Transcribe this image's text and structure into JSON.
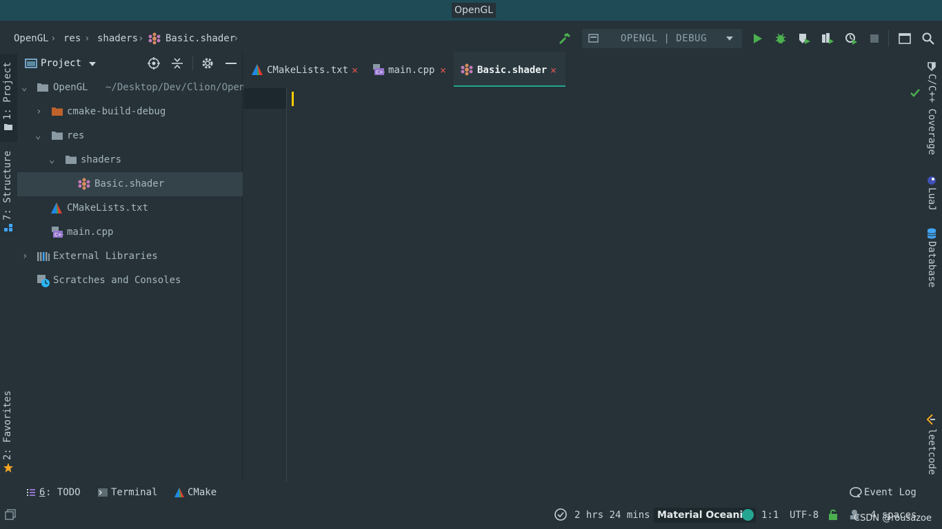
{
  "window": {
    "title": "OpenGL"
  },
  "breadcrumb": [
    "OpenGL",
    "res",
    "shaders",
    "Basic.shader"
  ],
  "toolbar": {
    "run_config": "OPENGL | DEBUG",
    "icons": [
      "hammer-icon",
      "config-icon",
      "chevron-down-icon",
      "run-icon",
      "debug-icon",
      "coverage-icon",
      "profile-icon",
      "attach-icon",
      "stop-icon",
      "terminal-icon",
      "search-icon"
    ]
  },
  "left_tabs": {
    "project": "1: Project",
    "structure": "7: Structure",
    "favorites": "2: Favorites"
  },
  "project_panel": {
    "title": "Project",
    "tree": [
      {
        "label": "OpenGL",
        "path": "~/Desktop/Dev/Clion/Open"
      },
      {
        "label": "cmake-build-debug"
      },
      {
        "label": "res"
      },
      {
        "label": "shaders"
      },
      {
        "label": "Basic.shader"
      },
      {
        "label": "CMakeLists.txt"
      },
      {
        "label": "main.cpp"
      },
      {
        "label": "External Libraries"
      },
      {
        "label": "Scratches and Consoles"
      }
    ]
  },
  "editor_tabs": [
    {
      "label": "CMakeLists.txt",
      "close": "×"
    },
    {
      "label": "main.cpp",
      "close": "×"
    },
    {
      "label": "Basic.shader",
      "close": "×"
    }
  ],
  "right_tabs": {
    "coverage": "C/C++ Coverage",
    "luaj": "LuaJ",
    "database": "Database",
    "leetcode": "leetcode"
  },
  "bottom_tools": {
    "todo_num": "6",
    "todo": ": TODO",
    "terminal": "Terminal",
    "cmake": "CMake",
    "event_log": "Event Log"
  },
  "status": {
    "time": "2 hrs 24 mins",
    "theme": "Material Oceanic",
    "position": "1:1",
    "encoding": "UTF-8",
    "indent": "4 spaces",
    "watermark": "CSDN @rousazoe"
  },
  "colors": {
    "accent": "#24a693",
    "caret": "#ffcc00",
    "close": "#e0544d",
    "run": "#4caf50"
  }
}
